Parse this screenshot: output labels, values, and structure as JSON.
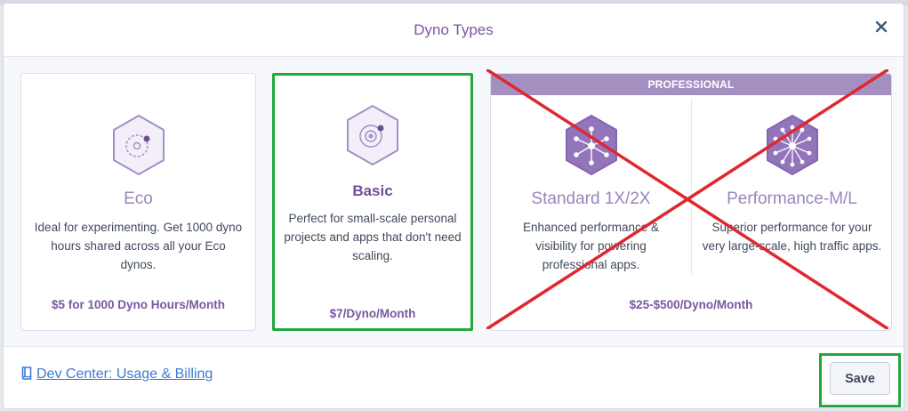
{
  "modal": {
    "title": "Dyno Types"
  },
  "cards": {
    "eco": {
      "name": "Eco",
      "description": "Ideal for experimenting. Get 1000 dyno hours shared across all your Eco dynos.",
      "price": "$5 for 1000 Dyno Hours/Month"
    },
    "basic": {
      "name": "Basic",
      "description": "Perfect for small-scale personal projects and apps that don't need scaling.",
      "price": "$7/Dyno/Month"
    },
    "professional": {
      "banner": "PROFESSIONAL",
      "standard": {
        "name": "Standard 1X/2X",
        "description": "Enhanced performance & visibility for powering professional apps."
      },
      "performance": {
        "name": "Performance-M/L",
        "description": "Superior performance for your very large-scale, high traffic apps."
      },
      "price": "$25-$500/Dyno/Month"
    }
  },
  "footer": {
    "link_label": "Dev Center: Usage & Billing",
    "save_label": "Save"
  },
  "colors": {
    "accent_purple": "#79589f",
    "banner_purple": "#a390c0",
    "selection_green": "#22a83c",
    "strike_red": "#e0262f",
    "link_blue": "#3a7bd5"
  },
  "icons": {
    "close": "close-icon",
    "eco": "eco-hex-icon",
    "basic": "basic-hex-icon",
    "standard": "standard-network-hex-icon",
    "performance": "performance-network-hex-icon",
    "link": "book-icon"
  }
}
